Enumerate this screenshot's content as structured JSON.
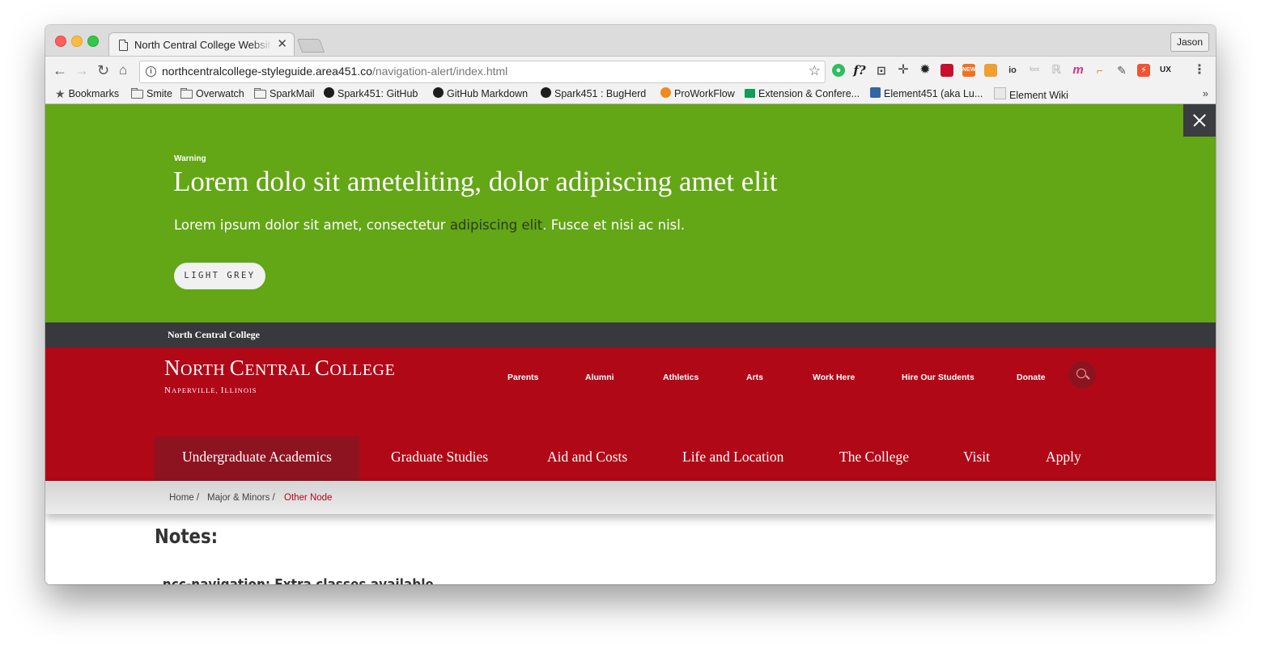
{
  "browser": {
    "tab_title": "North Central College Website",
    "tab_close": "✕",
    "profile_name": "Jason",
    "url_host": "northcentralcollege-styleguide.area451.co",
    "url_path": "/navigation-alert/index.html",
    "extensions": [
      "evernote-icon",
      "fontface-icon",
      "screen-icon",
      "move-icon",
      "gear-icon",
      "red-ext-icon",
      "new-ext-icon",
      "chart-ext-icon",
      "io-ext-icon",
      "font-ext-icon",
      "r-ext-icon",
      "m-ext-icon",
      "ruler-ext-icon",
      "eyedropper-icon",
      "bolt-ext-icon",
      "ux-ext-icon"
    ],
    "ext_labels": {
      "fontface": "f?",
      "new": "NEW",
      "io": "io",
      "font": "font",
      "m": "m",
      "ux": "UX"
    }
  },
  "bookmarks": [
    {
      "label": "Bookmarks",
      "icon": "star-icon"
    },
    {
      "label": "Smite",
      "icon": "folder-icon"
    },
    {
      "label": "Overwatch",
      "icon": "folder-icon"
    },
    {
      "label": "SparkMail",
      "icon": "folder-icon"
    },
    {
      "label": "Spark451: GitHub",
      "icon": "github-icon"
    },
    {
      "label": "GitHub Markdown",
      "icon": "github-icon"
    },
    {
      "label": "Spark451 : BugHerd",
      "icon": "bugherd-icon"
    },
    {
      "label": "ProWorkFlow",
      "icon": "proworkflow-icon"
    },
    {
      "label": "Extension & Confere...",
      "icon": "sheets-icon"
    },
    {
      "label": "Element451 (aka Lu...",
      "icon": "element-icon"
    },
    {
      "label": "Element Wiki",
      "icon": "element451-icon"
    }
  ],
  "bookmarks_more": "»",
  "alert": {
    "label": "Warning",
    "title": "Lorem dolo sit ameteliting, dolor adipiscing amet elit",
    "body_before": "Lorem ipsum dolor sit amet, consectetur ",
    "body_link": "adipiscing elit",
    "body_after": ". Fusce et nisi ac nisl.",
    "button": "LIGHT GREY",
    "bg_color": "#63a616"
  },
  "utility": {
    "brand": "North Central College"
  },
  "masthead": {
    "logo_main": "North Central College",
    "logo_sub": "Naperville, Illinois",
    "audience_nav": [
      "Parents",
      "Alumni",
      "Athletics",
      "Arts",
      "Work Here",
      "Hire Our Students",
      "Donate"
    ],
    "main_nav": [
      "Undergraduate Academics",
      "Graduate Studies",
      "Aid and Costs",
      "Life and Location",
      "The College",
      "Visit",
      "Apply"
    ],
    "active_main": "Undergraduate Academics",
    "brand_color": "#b10817"
  },
  "breadcrumb": {
    "home": "Home /",
    "parent": "Major & Minors /",
    "current": "Other Node"
  },
  "notes": {
    "title": "Notes:",
    "subtitle": ".ncc-navigation: Extra classes available"
  }
}
